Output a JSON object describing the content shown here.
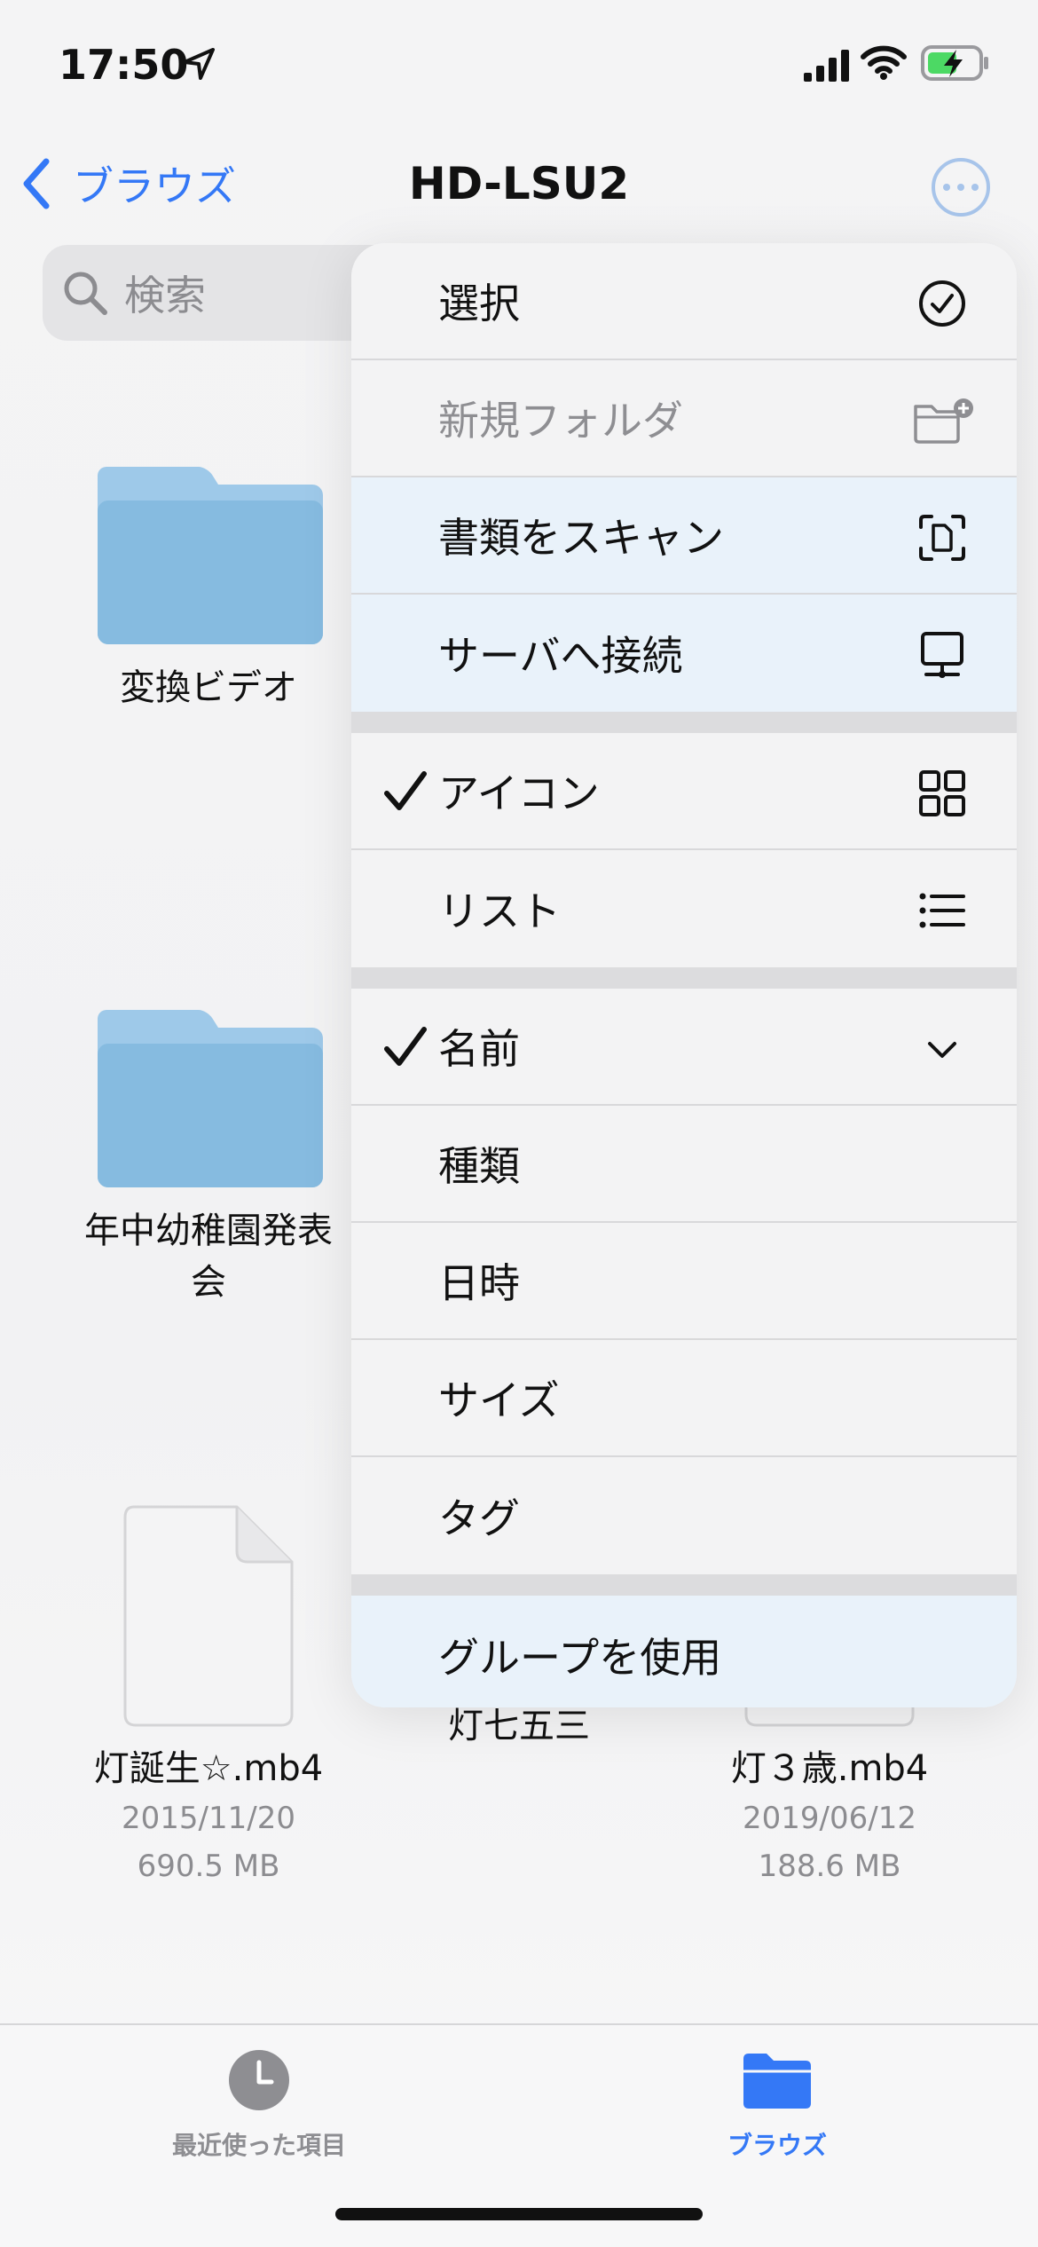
{
  "status_bar": {
    "time": "17:50"
  },
  "nav": {
    "back_label": "ブラウズ",
    "title": "HD-LSU2"
  },
  "search": {
    "placeholder": "検索"
  },
  "files": [
    {
      "name": "変換ビデオ",
      "kind": "folder"
    },
    {
      "name": "年中幼稚園発表会",
      "kind": "folder"
    },
    {
      "name": "灯誕生☆.mb4",
      "kind": "document",
      "date": "2015/11/20",
      "size": "690.5 MB"
    },
    {
      "name": "灯七五三",
      "kind": "folder"
    },
    {
      "name": "灯３歳.mb4",
      "kind": "document",
      "date": "2019/06/12",
      "size": "188.6 MB"
    }
  ],
  "menu": {
    "items": [
      {
        "label": "選択",
        "icon": "checkmark-circle-icon"
      },
      {
        "label": "新規フォルダ",
        "icon": "folder-badge-plus-icon",
        "disabled": true
      },
      {
        "label": "書類をスキャン",
        "icon": "doc-viewfinder-icon"
      },
      {
        "label": "サーバへ接続",
        "icon": "desktop-computer-icon"
      }
    ],
    "view_options": [
      {
        "label": "アイコン",
        "icon": "grid-icon",
        "checked": true
      },
      {
        "label": "リスト",
        "icon": "list-icon",
        "checked": false
      }
    ],
    "sort_options": [
      {
        "label": "名前",
        "checked": true,
        "icon": "chevron-down-icon"
      },
      {
        "label": "種類"
      },
      {
        "label": "日時"
      },
      {
        "label": "サイズ"
      },
      {
        "label": "タグ"
      }
    ],
    "group_label": "グループを使用"
  },
  "tab_bar": {
    "recents_label": "最近使った項目",
    "browse_label": "ブラウズ",
    "active_color": "#3478f6",
    "inactive_color": "#8e8e92"
  },
  "colors": {
    "accent": "#3478f6",
    "folder": "#86bbe0"
  }
}
